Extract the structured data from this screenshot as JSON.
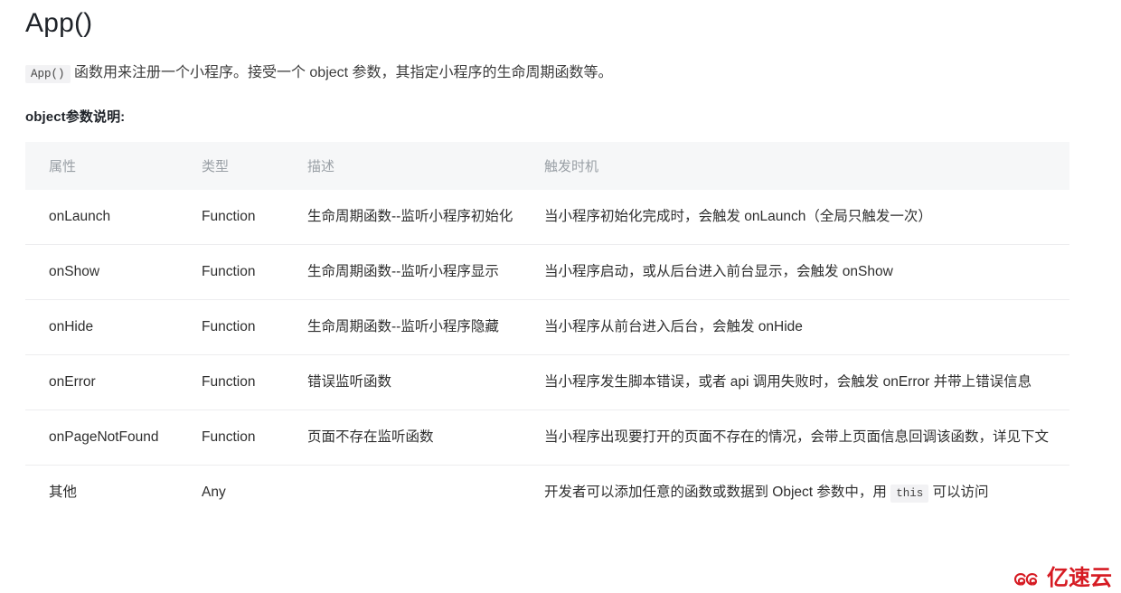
{
  "page": {
    "title": "App()",
    "intro": {
      "code": "App()",
      "text": " 函数用来注册一个小程序。接受一个 object 参数，其指定小程序的生命周期函数等。"
    },
    "sub_heading": "object参数说明:"
  },
  "table": {
    "columns": [
      "属性",
      "类型",
      "描述",
      "触发时机"
    ],
    "rows": [
      {
        "attr": "onLaunch",
        "type": "Function",
        "desc": "生命周期函数--监听小程序初始化",
        "when": "当小程序初始化完成时，会触发 onLaunch（全局只触发一次）"
      },
      {
        "attr": "onShow",
        "type": "Function",
        "desc": "生命周期函数--监听小程序显示",
        "when": "当小程序启动，或从后台进入前台显示，会触发 onShow"
      },
      {
        "attr": "onHide",
        "type": "Function",
        "desc": "生命周期函数--监听小程序隐藏",
        "when": "当小程序从前台进入后台，会触发 onHide"
      },
      {
        "attr": "onError",
        "type": "Function",
        "desc": "错误监听函数",
        "when": "当小程序发生脚本错误，或者 api 调用失败时，会触发 onError 并带上错误信息"
      },
      {
        "attr": "onPageNotFound",
        "type": "Function",
        "desc": "页面不存在监听函数",
        "when": "当小程序出现要打开的页面不存在的情况，会带上页面信息回调该函数，详见下文"
      },
      {
        "attr": "其他",
        "type": "Any",
        "desc": "",
        "when_parts": {
          "before": "开发者可以添加任意的函数或数据到 Object 参数中，用 ",
          "code": "this",
          "after": " 可以访问"
        }
      }
    ]
  },
  "watermark": {
    "text": "亿速云",
    "color": "#d61b23",
    "icon": "cloud-logo-icon"
  },
  "colors": {
    "header_bg": "#f6f7f8",
    "header_text": "#9aa0a6",
    "row_border": "#ededef",
    "code_bg": "#f2f2f4",
    "body_text": "#2f2f2f",
    "title_text": "#1f2329"
  }
}
